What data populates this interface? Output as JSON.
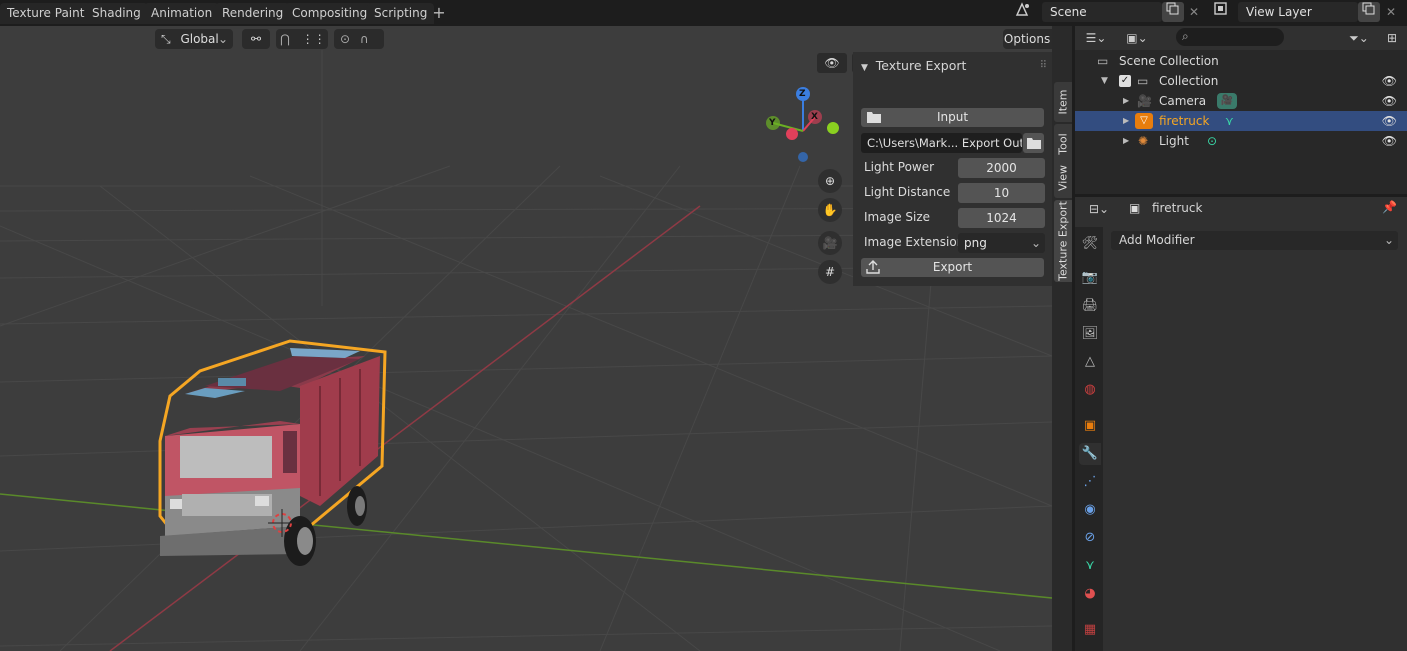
{
  "workspace_tabs": [
    "Texture Paint",
    "Shading",
    "Animation",
    "Rendering",
    "Compositing",
    "Scripting"
  ],
  "add_workspace": "+",
  "scene": {
    "name": "Scene"
  },
  "view_layer": {
    "name": "View Layer"
  },
  "viewport_header": {
    "orientation": "Global",
    "options_label": "Options"
  },
  "npanel": {
    "title": "Texture Export",
    "input_label": "Input",
    "output_path": "C:\\Users\\Mark... Export Output",
    "fields": [
      {
        "label": "Light Power",
        "value": "2000"
      },
      {
        "label": "Light Distance",
        "value": "10"
      },
      {
        "label": "Image Size",
        "value": "1024"
      }
    ],
    "extension_label": "Image Extension",
    "extension_value": "png",
    "export_label": "Export"
  },
  "ntabs": [
    "Item",
    "Tool",
    "View",
    "Texture Export"
  ],
  "gizmo": {
    "z": "Z",
    "y": "Y",
    "x": "X"
  },
  "outliner": {
    "root": "Scene Collection",
    "collection": "Collection",
    "items": [
      {
        "name": "Camera",
        "icon": "camera-icon",
        "selected": false
      },
      {
        "name": "firetruck",
        "icon": "mesh-icon",
        "selected": true
      },
      {
        "name": "Light",
        "icon": "light-icon",
        "selected": false
      }
    ]
  },
  "properties": {
    "object_name": "firetruck",
    "add_modifier": "Add Modifier"
  },
  "colors": {
    "accent_blue": "#4772b3",
    "selection_row": "#334d80",
    "outline_orange": "#f5a623",
    "object_orange": "#e87d0d"
  }
}
